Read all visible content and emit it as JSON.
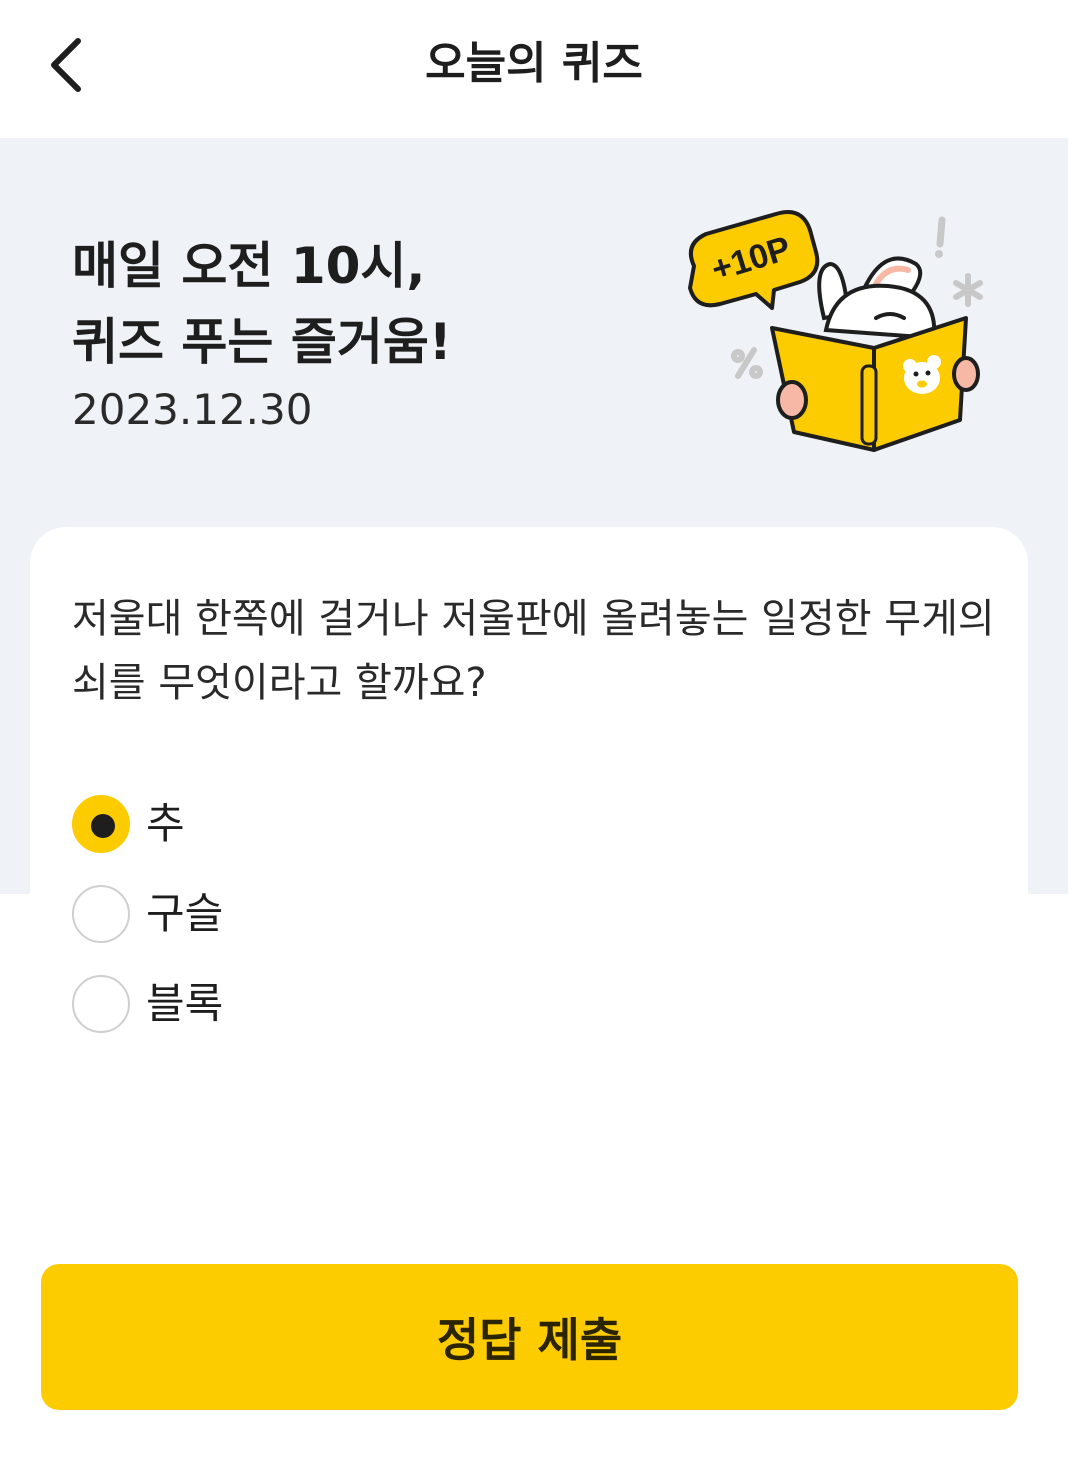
{
  "header": {
    "title": "오늘의 퀴즈",
    "back_icon": "chevron-left-icon"
  },
  "hero": {
    "title": "매일 오전 10시,\n퀴즈 푸는 즐거움!",
    "date": "2023.12.30",
    "badge_text": "+10P",
    "illustration": "bunny-reading-book"
  },
  "quiz": {
    "question": "저울대 한쪽에 걸거나 저울판에 올려놓는 일정한 무게의 쇠를 무엇이라고 할까요?",
    "options": [
      {
        "label": "추",
        "selected": true
      },
      {
        "label": "구슬",
        "selected": false
      },
      {
        "label": "블록",
        "selected": false
      }
    ]
  },
  "submit": {
    "label": "정답 제출"
  },
  "colors": {
    "accent": "#fccb00",
    "hero_bg": "#eff2f6",
    "text": "#1e1e1e"
  }
}
